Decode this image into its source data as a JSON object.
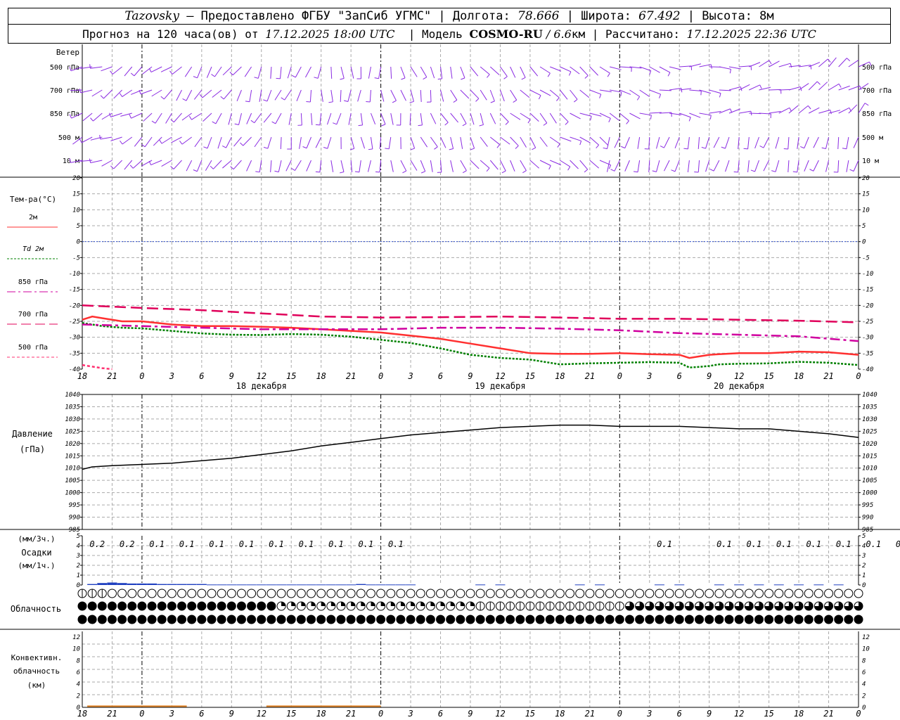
{
  "header": {
    "station": "Tazovsky",
    "provider": " — Предоставлено ФГБУ \"ЗапСиб УГМС\" | Долгота: ",
    "lon": "78.666",
    "lat_label": " | Широта: ",
    "lat": "67.492",
    "alt_label": " | Высота: ",
    "alt": "8м"
  },
  "subheader": {
    "prefix": "Прогноз на 120 часа(ов) от ",
    "start": "17.12.2025 18:00 UTC",
    "model_label": "  | Модель ",
    "model": "COSMO-RU",
    "res": " / 6.6",
    "res_unit": "км | Рассчитано: ",
    "calc": "17.12.2025 22:36 UTC"
  },
  "wind_panel": {
    "title": "Ветер",
    "levels": [
      "500 гПа",
      "700 гПа",
      "850 гПа",
      "500 м",
      "10  м"
    ]
  },
  "temp_panel": {
    "title": "Тем-ра(°С)",
    "legend": [
      {
        "label": "2м",
        "color": "#ff3030",
        "dash": ""
      },
      {
        "label": "Td  2м",
        "color": "#008000",
        "dash": "3,2"
      },
      {
        "label": "850 гПа",
        "color": "#d0009f",
        "dash": "12,4,3,4"
      },
      {
        "label": "700 гПа",
        "color": "#e0005a",
        "dash": "14,6"
      },
      {
        "label": "500 гПа",
        "color": "#ff3070",
        "dash": "4,3"
      }
    ],
    "ticks": [
      "20",
      "15",
      "10",
      "5",
      "0",
      "-5",
      "-10",
      "-15",
      "-20",
      "-25",
      "-30",
      "-35",
      "-40"
    ]
  },
  "time_axis": {
    "labels": [
      "18",
      "21",
      "0",
      "3",
      "6",
      "9",
      "12",
      "15",
      "18",
      "21",
      "0",
      "3",
      "6",
      "9",
      "12",
      "15",
      "18",
      "21",
      "0",
      "3",
      "6",
      "9",
      "12",
      "15",
      "18",
      "21",
      "0"
    ],
    "dates": [
      "18 декабря",
      "19 декабря",
      "20 декабря"
    ]
  },
  "pressure_panel": {
    "title1": "Давление",
    "title2": "(гПа)",
    "ticks": [
      "1040",
      "1035",
      "1030",
      "1025",
      "1020",
      "1015",
      "1010",
      "1005",
      "1000",
      "995",
      "990",
      "985"
    ]
  },
  "precip_panel": {
    "label_top": "(мм/3ч.)",
    "label_mid": "Осадки",
    "label_bot": "(мм/1ч.)",
    "ticks": [
      "5",
      "4",
      "3",
      "2",
      "1",
      "0"
    ],
    "amounts": [
      {
        "h": 3,
        "v": "0.2"
      },
      {
        "h": 6,
        "v": "0.2"
      },
      {
        "h": 9,
        "v": "0.1"
      },
      {
        "h": 12,
        "v": "0.1"
      },
      {
        "h": 15,
        "v": "0.1"
      },
      {
        "h": 18,
        "v": "0.1"
      },
      {
        "h": 21,
        "v": "0.1"
      },
      {
        "h": 24,
        "v": "0.1"
      },
      {
        "h": 27,
        "v": "0.1"
      },
      {
        "h": 30,
        "v": "0.1"
      },
      {
        "h": 33,
        "v": "0.1"
      },
      {
        "h": 60,
        "v": "0.1"
      },
      {
        "h": 66,
        "v": "0.1"
      },
      {
        "h": 69,
        "v": "0.1"
      },
      {
        "h": 72,
        "v": "0.1"
      },
      {
        "h": 75,
        "v": "0.1"
      },
      {
        "h": 78,
        "v": "0.1"
      },
      {
        "h": 81,
        "v": "0.1"
      },
      {
        "h": 84,
        "v": "0.1"
      },
      {
        "h": 87,
        "v": "0.1"
      }
    ]
  },
  "cloud_panel": {
    "title": "Облачность"
  },
  "conv_panel": {
    "label1": "Конвективн.",
    "label2": "облачность",
    "label3": "(км)",
    "ticks": [
      "12",
      "10",
      "8",
      "6",
      "4",
      "2",
      "0"
    ]
  },
  "chart_data": {
    "type": "line",
    "x_unit": "hours from 17.12.2025 18:00 UTC",
    "x_range": [
      0,
      78
    ],
    "temperature": {
      "ylim": [
        -40,
        20
      ],
      "series": [
        {
          "name": "2м",
          "x": [
            0,
            1,
            2,
            4,
            6,
            9,
            12,
            15,
            18,
            21,
            24,
            27,
            30,
            33,
            36,
            39,
            42,
            45,
            48,
            51,
            54,
            57,
            60,
            61,
            62,
            63,
            64,
            66,
            69,
            72,
            75,
            78
          ],
          "values": [
            -24.5,
            -23.5,
            -24,
            -25,
            -25,
            -26,
            -26.5,
            -26.5,
            -26.7,
            -27,
            -27.5,
            -28,
            -28.5,
            -29.5,
            -30.5,
            -32,
            -33.5,
            -35,
            -35.2,
            -35.2,
            -35,
            -35.3,
            -35.5,
            -36.5,
            -36,
            -35.5,
            -35.3,
            -35,
            -35,
            -34.5,
            -34.7,
            -35.5
          ]
        },
        {
          "name": "Td  2м",
          "x": [
            0,
            2,
            4,
            6,
            9,
            12,
            15,
            18,
            21,
            24,
            27,
            30,
            33,
            36,
            39,
            42,
            45,
            48,
            51,
            54,
            57,
            60,
            61,
            62,
            63,
            64,
            66,
            69,
            72,
            75,
            78
          ],
          "values": [
            -25.5,
            -26.5,
            -27,
            -27.2,
            -28,
            -28.8,
            -29.2,
            -29.3,
            -29,
            -29.2,
            -29.8,
            -30.8,
            -31.8,
            -33.5,
            -35.5,
            -36.5,
            -37,
            -38.5,
            -38.2,
            -38,
            -37.8,
            -38,
            -39.5,
            -39.3,
            -39,
            -38.5,
            -38.3,
            -38.2,
            -37.7,
            -38,
            -38.7
          ]
        },
        {
          "name": "850 гПа",
          "x": [
            0,
            6,
            12,
            18,
            24,
            30,
            36,
            42,
            48,
            54,
            60,
            66,
            72,
            78
          ],
          "values": [
            -26,
            -26.5,
            -27,
            -27.5,
            -27.5,
            -27.5,
            -27,
            -27,
            -27.3,
            -27.8,
            -28.7,
            -29.2,
            -29.7,
            -31.2
          ]
        },
        {
          "name": "700 гПа",
          "x": [
            0,
            6,
            12,
            18,
            24,
            30,
            36,
            42,
            48,
            54,
            60,
            66,
            72,
            78
          ],
          "values": [
            -20,
            -20.8,
            -21.5,
            -22.5,
            -23.5,
            -23.8,
            -23.7,
            -23.5,
            -23.8,
            -24.2,
            -24.2,
            -24.5,
            -24.8,
            -25.3
          ]
        },
        {
          "name": "500 гПа",
          "x": [
            0,
            1,
            2,
            3
          ],
          "values": [
            -38.7,
            -39.2,
            -39.7,
            -40
          ]
        }
      ]
    },
    "pressure": {
      "ylim": [
        985,
        1040
      ],
      "series": [
        {
          "name": "pressure",
          "x": [
            0,
            1,
            3,
            6,
            9,
            12,
            15,
            18,
            21,
            24,
            27,
            30,
            33,
            36,
            39,
            42,
            45,
            48,
            51,
            54,
            57,
            60,
            63,
            66,
            69,
            72,
            75,
            78
          ],
          "values": [
            1009.5,
            1010.5,
            1011,
            1011.5,
            1012,
            1013,
            1014,
            1015.5,
            1017,
            1019,
            1020.5,
            1022,
            1023.5,
            1024.5,
            1025.5,
            1026.5,
            1027,
            1027.5,
            1027.5,
            1027,
            1027,
            1027,
            1026.5,
            1026,
            1026,
            1025,
            1024,
            1022.5
          ]
        }
      ]
    },
    "precip_bars_mm1h": {
      "x": [
        1,
        2,
        3,
        4,
        5,
        6,
        7,
        8,
        9,
        10,
        11,
        12,
        13,
        14,
        15,
        16,
        17,
        18,
        19,
        20,
        21,
        22,
        23,
        24,
        25,
        26,
        27,
        28,
        29,
        30,
        31,
        32,
        33,
        40,
        42,
        50,
        52,
        58,
        60,
        64,
        66,
        68,
        70,
        72,
        74,
        76
      ],
      "values": [
        0.1,
        0.2,
        0.25,
        0.2,
        0.15,
        0.15,
        0.15,
        0.1,
        0.1,
        0.1,
        0.1,
        0.1,
        0.05,
        0.05,
        0.05,
        0.05,
        0.05,
        0.05,
        0.05,
        0.05,
        0.05,
        0.05,
        0.05,
        0.05,
        0.05,
        0.05,
        0.05,
        0.1,
        0.05,
        0.05,
        0.05,
        0.05,
        0.05,
        0.05,
        0.05,
        0.05,
        0.05,
        0.05,
        0.05,
        0.05,
        0.05,
        0.05,
        0.05,
        0.05,
        0.05,
        0.05
      ]
    },
    "conv_cloud_km": {
      "segments": [
        {
          "x": [
            0.5,
            10.5
          ],
          "value": 0.2
        },
        {
          "x": [
            18.5,
            30
          ],
          "value": 0.2
        }
      ]
    }
  }
}
